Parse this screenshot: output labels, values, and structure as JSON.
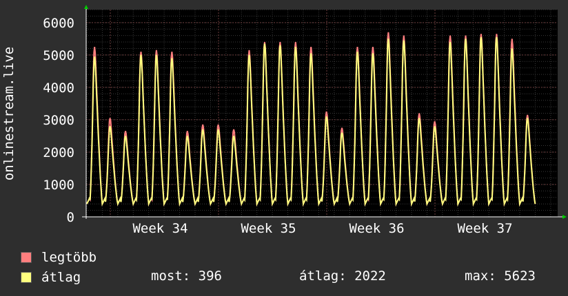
{
  "chart_data": {
    "type": "line",
    "ylabel": "onlinestream.live",
    "yticks": [
      0,
      1000,
      2000,
      3000,
      4000,
      5000,
      6000
    ],
    "ylim": [
      0,
      6400
    ],
    "xticks": [
      "Week 34",
      "Week 35",
      "Week 36",
      "Week 37"
    ],
    "grid": true,
    "series": [
      {
        "name": "legtöbb",
        "color": "#ff7f7f"
      },
      {
        "name": "átlag",
        "color": "#ffff7f"
      }
    ],
    "daily_peaks": {
      "legtöbb": [
        5250,
        3050,
        2650,
        5100,
        5150,
        5100,
        2650,
        2850,
        2850,
        2700,
        5150,
        5400,
        5400,
        5400,
        5250,
        3250,
        2750,
        5250,
        5250,
        5700,
        5600,
        3200,
        2950,
        5600,
        5600,
        5650,
        5650,
        5500,
        3150
      ],
      "átlag": [
        4950,
        2800,
        2500,
        5000,
        5000,
        4900,
        2500,
        2700,
        2700,
        2500,
        5000,
        5350,
        5300,
        5250,
        5050,
        3100,
        2600,
        5100,
        5050,
        5500,
        5450,
        3050,
        2800,
        5400,
        5500,
        5550,
        5550,
        5200,
        3050
      ]
    },
    "daily_min": 400,
    "legend": {
      "most_label": "most:",
      "most": "396",
      "atlag_label": "átlag:",
      "atlag": "2022",
      "max_label": "max:",
      "max": "5623"
    }
  }
}
